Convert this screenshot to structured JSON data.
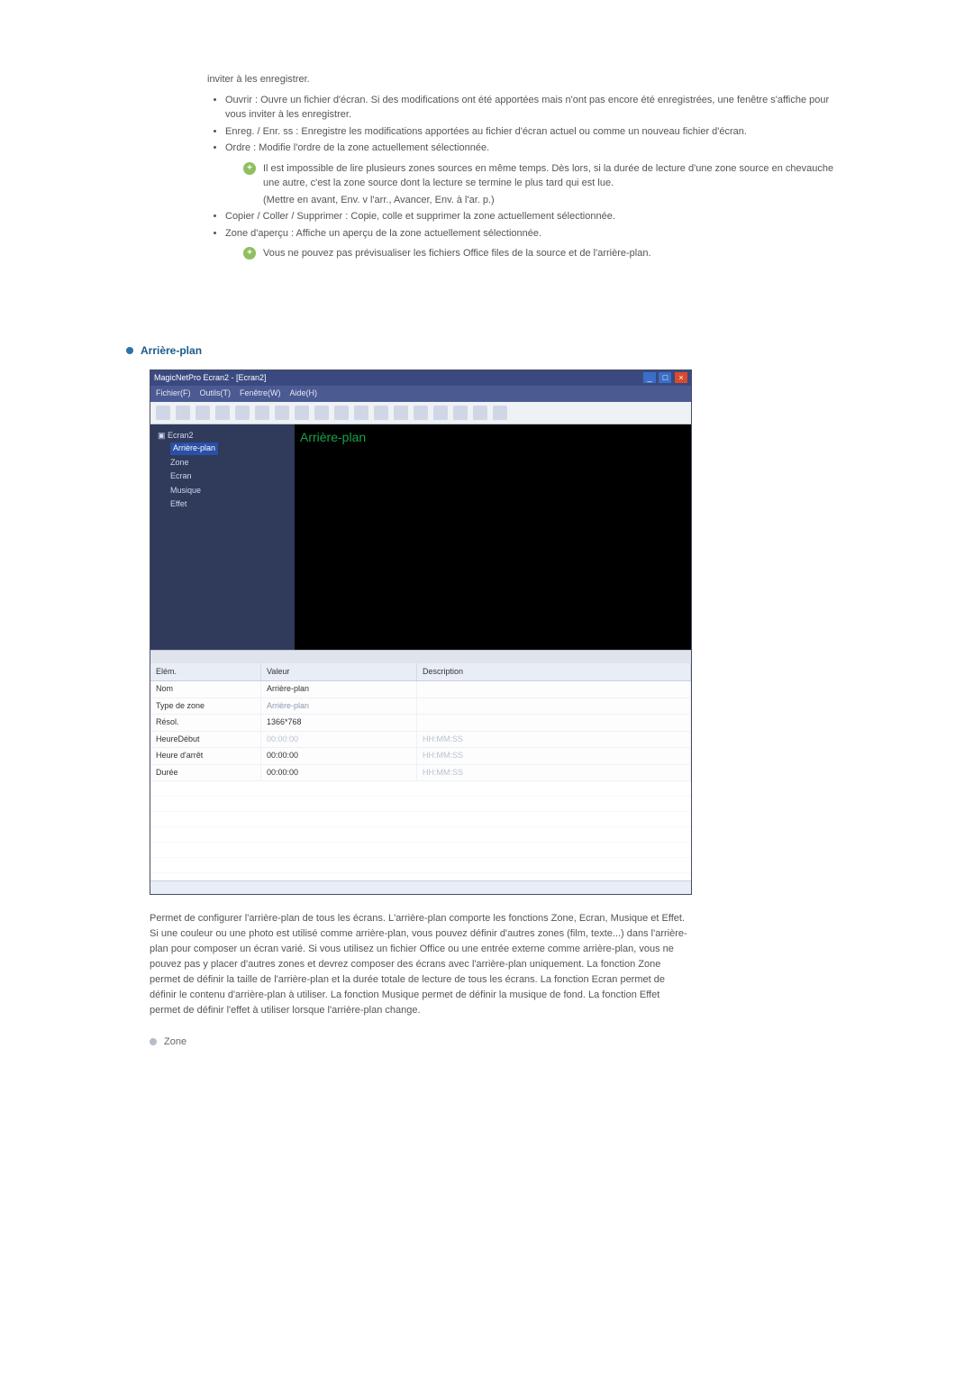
{
  "intro_tail": "inviter à les enregistrer.",
  "bullets": [
    "Ouvrir : Ouvre un fichier d'écran. Si des modifications ont été apportées mais n'ont pas encore été enregistrées, une fenêtre s'affiche pour vous inviter à les enregistrer.",
    "Enreg. / Enr. ss : Enregistre les modifications apportées au fichier d'écran actuel ou comme un nouveau fichier d'écran.",
    "Ordre : Modifie l'ordre de la zone actuellement sélectionnée."
  ],
  "order_note_lines": [
    "Il est impossible de lire plusieurs zones sources en même temps. Dès lors, si la durée de lecture d'une zone source en chevauche une autre, c'est la zone source dont la lecture se termine le plus tard qui est lue.",
    "(Mettre en avant, Env. v l'arr., Avancer, Env. à l'ar. p.)"
  ],
  "bullets2": [
    "Copier / Coller / Supprimer : Copie, colle et supprimer la zone actuellement sélectionnée.",
    "Zone d'aperçu : Affiche un aperçu de la zone actuellement sélectionnée."
  ],
  "preview_note": "Vous ne pouvez pas prévisualiser les fichiers Office files de la source et de l'arrière-plan.",
  "section_title": "Arrière-plan",
  "app": {
    "title": "MagicNetPro Ecran2 - [Ecran2]",
    "menus": [
      "Fichier(F)",
      "Outils(T)",
      "Fenêtre(W)",
      "Aide(H)"
    ],
    "tree": {
      "root": "Ecran2",
      "selected": "Arrière-plan",
      "children": [
        "Zone",
        "Ecran",
        "Musique",
        "Effet"
      ]
    },
    "canvas_label": "Arrière-plan",
    "sheet": {
      "headers": [
        "Elém.",
        "Valeur",
        "Description"
      ],
      "rows": [
        {
          "k": "Nom",
          "v": "Arrière-plan",
          "d": ""
        },
        {
          "k": "Type de zone",
          "v": "Arrière-plan",
          "d": "",
          "muted": true
        },
        {
          "k": "Résol.",
          "v": "1366*768",
          "d": ""
        },
        {
          "k": "HeureDébut",
          "v": "00:00:00",
          "d": "HH:MM:SS",
          "dim": true
        },
        {
          "k": "Heure d'arrêt",
          "v": "00:00:00",
          "d": "HH:MM:SS"
        },
        {
          "k": "Durée",
          "v": "00:00:00",
          "d": "HH:MM:SS"
        }
      ]
    }
  },
  "paragraph": "Permet de configurer l'arrière-plan de tous les écrans. L'arrière-plan comporte les fonctions Zone, Ecran, Musique et Effet. Si une couleur ou une photo est utilisé comme arrière-plan, vous pouvez définir d'autres zones (film, texte...) dans l'arrière-plan pour composer un écran varié. Si vous utilisez un fichier Office ou une entrée externe comme arrière-plan, vous ne pouvez pas y placer d'autres zones et devrez composer des écrans avec l'arrière-plan uniquement. La fonction Zone permet de définir la taille de l'arrière-plan et la durée totale de lecture de tous les écrans. La fonction Ecran permet de définir le contenu d'arrière-plan à utiliser. La fonction Musique permet de définir la musique de fond. La fonction Effet permet de définir l'effet à utiliser lorsque l'arrière-plan change.",
  "sub_item": "Zone"
}
